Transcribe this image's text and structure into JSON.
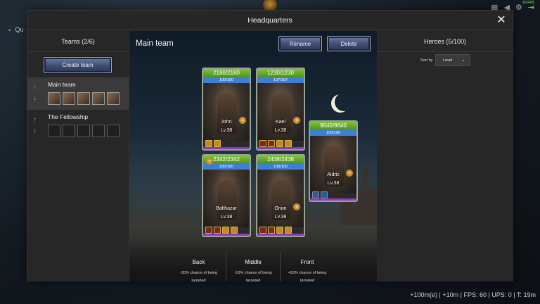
{
  "background": {
    "quest_label": "Qu",
    "fps_badge": "60 FPS",
    "stats_text": "+100m(e) | +10m | FPS: 60 | UPS: 0 | T: 19m"
  },
  "modal": {
    "title": "Headquarters",
    "close_symbol": "✕"
  },
  "teams": {
    "title": "Teams (2/6)",
    "create_label": "Create team",
    "list": [
      {
        "name": "Main team",
        "selected": true
      },
      {
        "name": "The Fellowship",
        "selected": false
      }
    ]
  },
  "main": {
    "title": "Main team",
    "rename_label": "Rename",
    "delete_label": "Delete",
    "heroes": [
      {
        "name": "John",
        "level": "Lv.38",
        "hp": "2180/2180",
        "mp": "100/100"
      },
      {
        "name": "Kael",
        "level": "Lv.38",
        "hp": "1230/1230",
        "mp": "107/107"
      },
      {
        "name": "Aldric",
        "level": "Lv.38",
        "hp": "9640/9640",
        "mp": "100/100"
      },
      {
        "name": "Balthazar",
        "level": "Lv.38",
        "hp": "2342/2342",
        "mp": "100/100"
      },
      {
        "name": "Orion",
        "level": "Lv.38",
        "hp": "2438/2438",
        "mp": "100/100"
      }
    ],
    "lanes": [
      {
        "name": "Back",
        "note1": "-30% chance of being",
        "note2": "targeted"
      },
      {
        "name": "Middle",
        "note1": "-10% chance of being",
        "note2": "targeted"
      },
      {
        "name": "Front",
        "note1": "+50% chance of being",
        "note2": "targeted"
      }
    ]
  },
  "heroes_panel": {
    "title": "Heroes (5/100)",
    "sort_label": "Sort by",
    "sort_value": "Level"
  },
  "colors": {
    "hp_bar": "#7dc53a",
    "mp_bar": "#3b7fd6",
    "rarity": "#8d3ac0"
  }
}
